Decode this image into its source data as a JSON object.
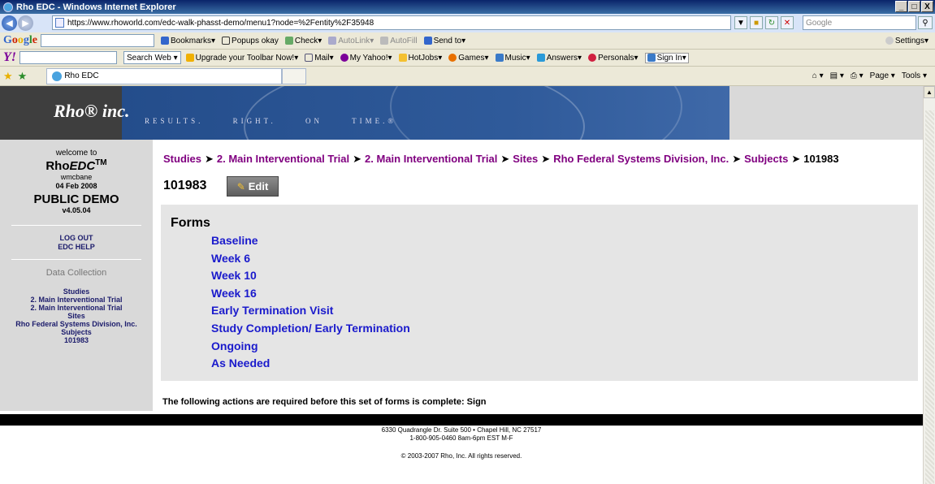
{
  "browser": {
    "window_title": "Rho EDC - Windows Internet Explorer",
    "window_buttons": [
      "_",
      "□",
      "X"
    ],
    "address": "https://www.rhoworld.com/edc-walk-phasst-demo/menu1?node=%2Fentity%2F35948",
    "search_placeholder": "Google",
    "google_toolbar": {
      "bookmarks": "Bookmarks",
      "popups": "Popups okay",
      "check": "Check",
      "autolink": "AutoLink",
      "autofill": "AutoFill",
      "send_to": "Send to",
      "settings": "Settings"
    },
    "yahoo_toolbar": {
      "search_web": "Search Web",
      "upgrade": "Upgrade your Toolbar Now!",
      "mail": "Mail",
      "my_yahoo": "My Yahoo!",
      "hotjobs": "HotJobs",
      "games": "Games",
      "music": "Music",
      "answers": "Answers",
      "personals": "Personals",
      "sign_in": "Sign In"
    },
    "tab_title": "Rho EDC",
    "tab_tools": {
      "page": "Page",
      "tools": "Tools"
    }
  },
  "banner": {
    "logo": "Rho® inc.",
    "tagline": "RESULTS. RIGHT. ON TIME.®"
  },
  "sidebar": {
    "welcome": "welcome to",
    "brand_prefix": "Rho",
    "brand_suffix": "EDC",
    "brand_tm": "TM",
    "username": "wmcbane",
    "date": "04 Feb 2008",
    "demo_label": "PUBLIC DEMO",
    "version": "v4.05.04",
    "logout": "LOG OUT",
    "help": "EDC HELP",
    "section_title": "Data Collection",
    "nav": [
      "Studies",
      "2. Main Interventional Trial",
      "2. Main Interventional Trial",
      "Sites",
      "Rho Federal Systems Division, Inc.",
      "Subjects",
      "101983"
    ]
  },
  "breadcrumb": {
    "items": [
      "Studies",
      "2. Main Interventional Trial",
      "2. Main Interventional Trial",
      "Sites",
      "Rho Federal Systems Division, Inc.",
      "Subjects"
    ],
    "current": "101983"
  },
  "subject": {
    "id": "101983",
    "edit_label": "Edit"
  },
  "forms": {
    "heading": "Forms",
    "items": [
      "Baseline",
      "Week 6",
      "Week 10",
      "Week 16",
      "Early Termination Visit",
      "Study Completion/ Early Termination",
      "Ongoing",
      "As Needed"
    ]
  },
  "required_note": "The following actions are required before this set of forms is complete: Sign",
  "footer": {
    "address": "6330 Quadrangle Dr. Suite 500 • Chapel Hill, NC 27517",
    "phone": "1-800-905-0460 8am-6pm EST M-F",
    "copyright": "© 2003-2007 Rho, Inc. All rights reserved."
  }
}
